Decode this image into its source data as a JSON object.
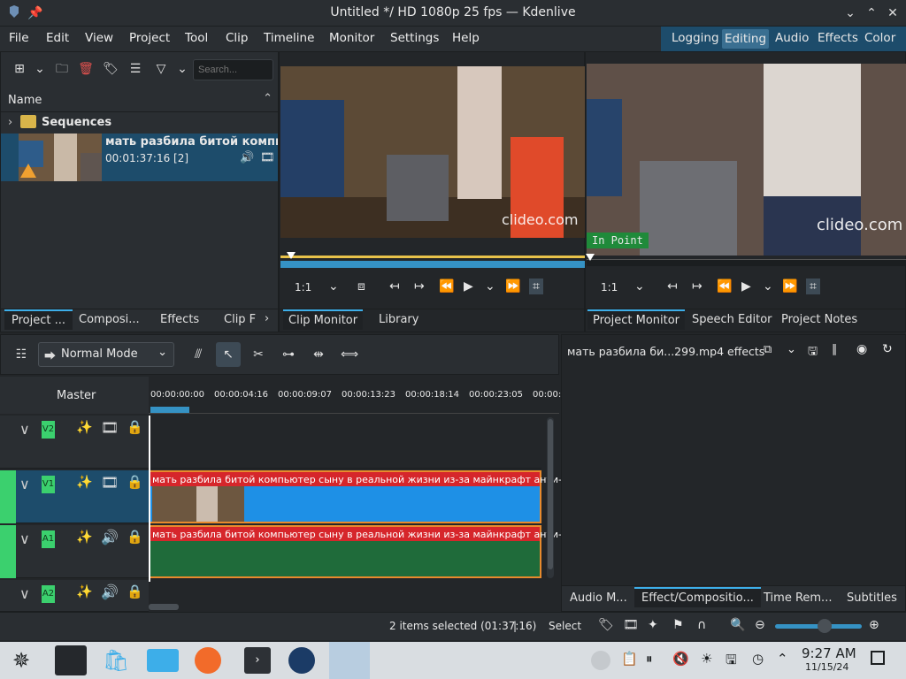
{
  "window": {
    "title": "Untitled */ HD 1080p 25 fps — Kdenlive",
    "app_icon": "kdenlive-icon",
    "pin_icon": "pin-icon"
  },
  "menu": [
    "File",
    "Edit",
    "View",
    "Project",
    "Tool",
    "Clip",
    "Timeline",
    "Monitor",
    "Settings",
    "Help"
  ],
  "layouts": {
    "items": [
      "Logging",
      "Editing",
      "Audio",
      "Effects",
      "Color"
    ],
    "active": "Editing"
  },
  "bin": {
    "search_placeholder": "Search...",
    "header_name": "Name",
    "folder": "Sequences",
    "clip": {
      "name": "мать разбила битой компьютер",
      "duration": "00:01:37:16 [2]"
    },
    "tabs": [
      "Project ...",
      "Composi...",
      "Effects",
      "Clip F"
    ]
  },
  "clip_monitor": {
    "watermark": "clideo.com",
    "zoom": "1:1",
    "tabs": [
      "Clip Monitor",
      "Library"
    ]
  },
  "project_monitor": {
    "watermark": "clideo.com",
    "in_point_label": "In Point",
    "zoom": "1:1",
    "tabs": [
      "Project Monitor",
      "Speech Editor",
      "Project Notes"
    ]
  },
  "timeline_toolbar": {
    "mode": "Normal Mode"
  },
  "timeline": {
    "master_label": "Master",
    "timecodes": [
      "00:00:00:00",
      "00:00:04:16",
      "00:00:09:07",
      "00:00:13:23",
      "00:00:18:14",
      "00:00:23:05",
      "00:00:"
    ],
    "tracks": [
      {
        "id": "V2",
        "type": "video"
      },
      {
        "id": "V1",
        "type": "video"
      },
      {
        "id": "A1",
        "type": "audio"
      },
      {
        "id": "A2",
        "type": "audio"
      }
    ],
    "clip_title_v1": "мать разбила битой компьютер сыну в реальной жизни из-за майнкрафт анти-гри",
    "clip_title_a1": "мать разбила битой компьютер сыну в реальной жизни из-за майнкрафт анти-гри"
  },
  "effects_panel": {
    "title": "мать разбила би...299.mp4 effects",
    "tabs": [
      "Audio M...",
      "Effect/Compositio...",
      "Time Rem...",
      "Subtitles"
    ]
  },
  "statusbar": {
    "selection": "2 items selected (01:37:16)",
    "separator": "|",
    "tool": "Select"
  },
  "taskbar": {
    "time": "9:27 AM",
    "date": "11/15/24"
  },
  "colors": {
    "accent": "#3daee9",
    "clip_header_red": "#d6262b",
    "video_clip_blue": "#1e90e6",
    "audio_clip_green": "#1f6b3a",
    "track_tag_green": "#3bd06e"
  }
}
